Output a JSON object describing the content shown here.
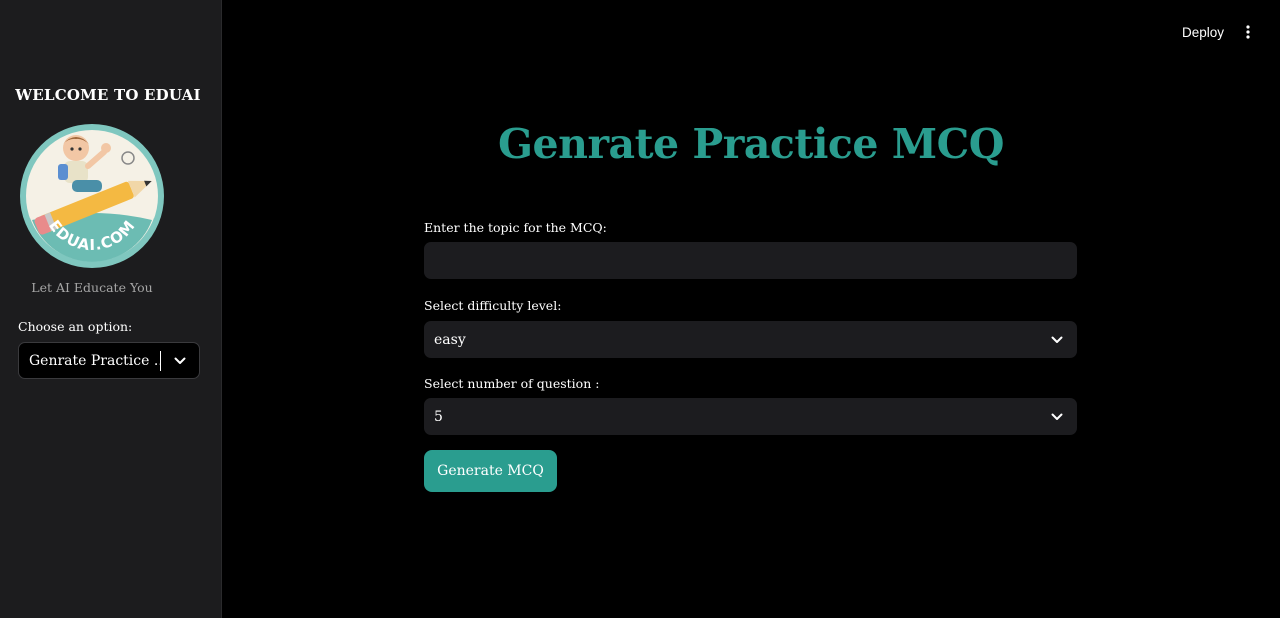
{
  "sidebar": {
    "title": "WELCOME TO EDUAI",
    "logo_text": "EDUAI.COM",
    "caption": "Let AI Educate You",
    "option_label": "Choose an option:",
    "option_value": "Genrate Practice ..."
  },
  "header": {
    "deploy_label": "Deploy"
  },
  "main": {
    "title": "Genrate Practice MCQ",
    "topic_label": "Enter the topic for the MCQ:",
    "topic_value": "",
    "difficulty_label": "Select difficulty level:",
    "difficulty_value": "easy",
    "count_label": "Select number of question :",
    "count_value": "5",
    "generate_button": "Generate MCQ"
  },
  "colors": {
    "accent": "#2a9d8f",
    "sidebar_bg": "#1c1c1e",
    "main_bg": "#000000",
    "input_bg": "#1c1c1f"
  },
  "icons": [
    "chevron-down-icon",
    "kebab-menu-icon",
    "logo-boy-on-pencil"
  ]
}
